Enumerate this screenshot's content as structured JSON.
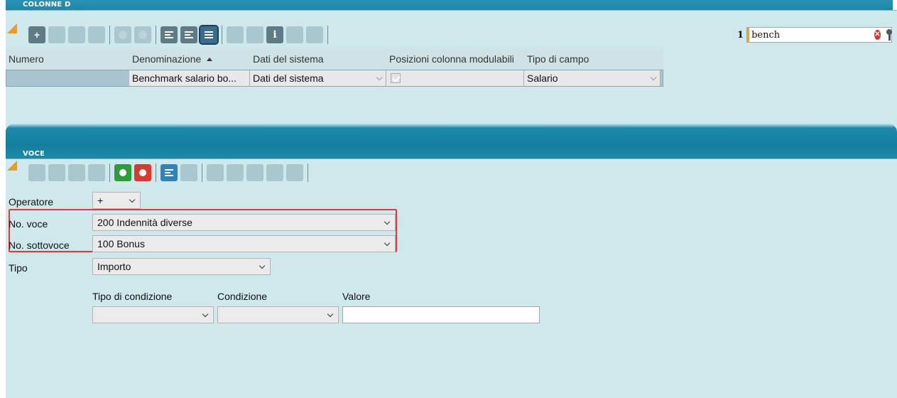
{
  "top_panel": {
    "title": "COLONNE D",
    "search": {
      "row_number": "1",
      "value": "bench"
    },
    "grid": {
      "columns": [
        "Numero",
        "Denominazione",
        "Dati del sistema",
        "Posizioni colonna modulabili",
        "Tipo di campo"
      ],
      "rows": [
        {
          "numero": "",
          "denominazione": "Benchmark salario bo...",
          "dati_del_sistema": "Dati del sistema",
          "posizioni_colonna_modulabili": true,
          "tipo_di_campo": "Salario"
        }
      ]
    }
  },
  "bottom_panel": {
    "title": "VOCE",
    "form": {
      "operatore": {
        "label": "Operatore",
        "value": "+"
      },
      "no_voce": {
        "label": "No. voce",
        "value": "200 Indennità diverse"
      },
      "no_sottovoce": {
        "label": "No. sottovoce",
        "value": "100 Bonus"
      },
      "tipo": {
        "label": "Tipo",
        "value": "Importo"
      },
      "conditions": {
        "tipo_di_condizione_label": "Tipo di condizione",
        "condizione_label": "Condizione",
        "valore_label": "Valore",
        "tipo_di_condizione_value": "",
        "condizione_value": "",
        "valore_value": ""
      }
    }
  },
  "colors": {
    "header_teal": "#1e86a6",
    "panel_bg": "#cfe8ec",
    "highlight_red": "#e0393b",
    "accent_orange": "#f29a1b"
  }
}
